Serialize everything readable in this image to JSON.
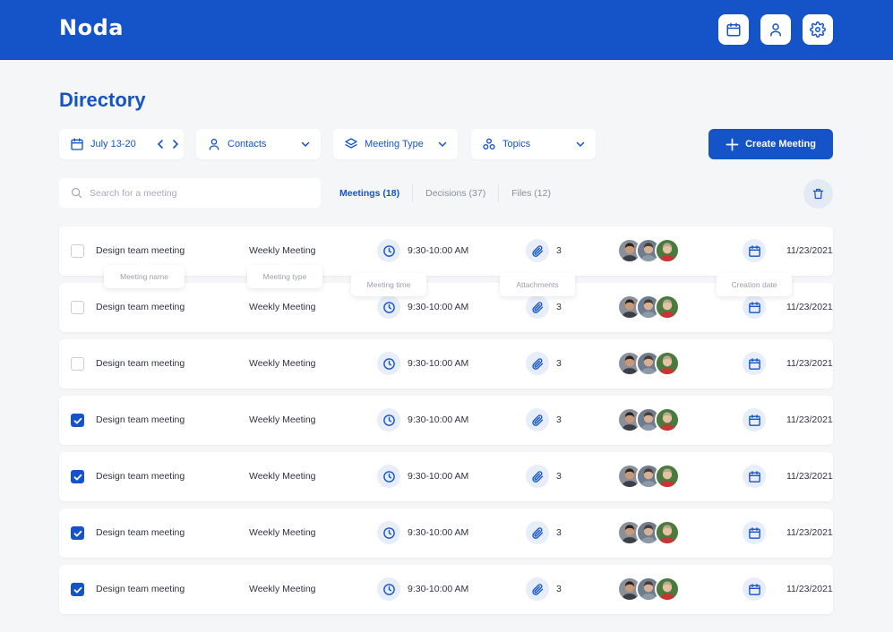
{
  "app": {
    "name": "Noda"
  },
  "header": {
    "icons": [
      "calendar-icon",
      "user-icon",
      "settings-icon"
    ]
  },
  "page": {
    "title": "Directory"
  },
  "filters": {
    "date_range": "July 13-20",
    "contacts": "Contacts",
    "meeting_type": "Meeting Type",
    "topics": "Topics"
  },
  "actions": {
    "create_meeting": "Create Meeting"
  },
  "search": {
    "placeholder": "Search for a meeting",
    "value": ""
  },
  "tabs": [
    {
      "label": "Meetings (18)",
      "active": true
    },
    {
      "label": "Decisions (37)",
      "active": false
    },
    {
      "label": "Files (12)",
      "active": false
    }
  ],
  "tooltips": {
    "name": "Meeting name",
    "type": "Meeting type",
    "time": "Meeting time",
    "attachments": "Attachments",
    "date": "Creation date"
  },
  "rows": [
    {
      "checked": false,
      "name": "Design team meeting",
      "type": "Weekly Meeting",
      "time": "9:30-10:00 AM",
      "attachments": "3",
      "date": "11/23/2021"
    },
    {
      "checked": false,
      "name": "Design team meeting",
      "type": "Weekly Meeting",
      "time": "9:30-10:00 AM",
      "attachments": "3",
      "date": "11/23/2021"
    },
    {
      "checked": false,
      "name": "Design team meeting",
      "type": "Weekly Meeting",
      "time": "9:30-10:00 AM",
      "attachments": "3",
      "date": "11/23/2021"
    },
    {
      "checked": true,
      "name": "Design team meeting",
      "type": "Weekly Meeting",
      "time": "9:30-10:00 AM",
      "attachments": "3",
      "date": "11/23/2021"
    },
    {
      "checked": true,
      "name": "Design team meeting",
      "type": "Weekly Meeting",
      "time": "9:30-10:00 AM",
      "attachments": "3",
      "date": "11/23/2021"
    },
    {
      "checked": true,
      "name": "Design team meeting",
      "type": "Weekly Meeting",
      "time": "9:30-10:00 AM",
      "attachments": "3",
      "date": "11/23/2021"
    },
    {
      "checked": true,
      "name": "Design team meeting",
      "type": "Weekly Meeting",
      "time": "9:30-10:00 AM",
      "attachments": "3",
      "date": "11/23/2021"
    }
  ],
  "colors": {
    "primary": "#1453c8",
    "background": "#f5f6f8",
    "icon_bg": "#e7eef9"
  }
}
